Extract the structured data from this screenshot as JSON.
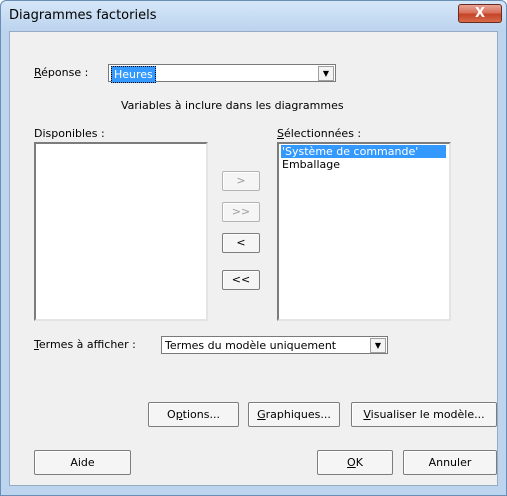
{
  "window": {
    "title": "Diagrammes factoriels",
    "close_glyph": "X"
  },
  "response": {
    "label": "Réponse :",
    "value": "Heures"
  },
  "variables_heading": "Variables à inclure dans les diagrammes",
  "available": {
    "label": "Disponibles :",
    "items": []
  },
  "selected": {
    "label": "Sélectionnées :",
    "items": [
      "'Système de commande'",
      "Emballage"
    ],
    "selected_index": 0
  },
  "move_buttons": {
    "add": ">",
    "add_all": ">>",
    "remove": "<",
    "remove_all": "<<"
  },
  "terms": {
    "label": "Termes à afficher :",
    "value": "Termes du modèle uniquement"
  },
  "buttons": {
    "options": "Options...",
    "graphs": "Graphiques...",
    "view_model": "Visualiser le modèle...",
    "help": "Aide",
    "ok": "OK",
    "cancel": "Annuler"
  },
  "colors": {
    "selection": "#3399ff",
    "dialog_bg": "#f0f0f0",
    "frame": "#bcd4ee",
    "close": "#c54428"
  }
}
